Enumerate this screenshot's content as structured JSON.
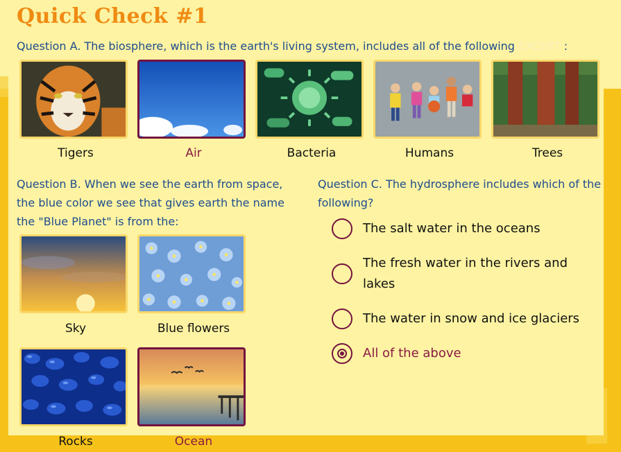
{
  "title": "Quick Check #1",
  "question_a": {
    "text": "Question A. The biosphere, which is the earth's living system, includes all of the following",
    "except_word": "EXCEPT",
    "trailing": ":",
    "choices": [
      {
        "label": "Tigers",
        "selected": false
      },
      {
        "label": "Air",
        "selected": true
      },
      {
        "label": "Bacteria",
        "selected": false
      },
      {
        "label": "Humans",
        "selected": false
      },
      {
        "label": "Trees",
        "selected": false
      }
    ]
  },
  "question_b": {
    "text": "Question B. When we see the earth from space, the blue color we see that gives earth the name the \"Blue Planet\" is from the:",
    "choices": [
      {
        "label": "Sky",
        "selected": false
      },
      {
        "label": "Blue flowers",
        "selected": false
      },
      {
        "label": "Rocks",
        "selected": false
      },
      {
        "label": "Ocean",
        "selected": true
      }
    ]
  },
  "question_c": {
    "text": "Question C. The hydrosphere includes which of the following?",
    "options": [
      {
        "label": "The salt water in the oceans",
        "selected": false
      },
      {
        "label": "The fresh water in the rivers and lakes",
        "selected": false
      },
      {
        "label": "The water in snow and ice glaciers",
        "selected": false
      },
      {
        "label": "All of the above",
        "selected": true
      }
    ]
  },
  "colors": {
    "title": "#ef8a12",
    "question_text": "#1f4c8f",
    "selected": "#74123f",
    "card_border": "#f9d86a",
    "background": "#fdf3a2"
  }
}
